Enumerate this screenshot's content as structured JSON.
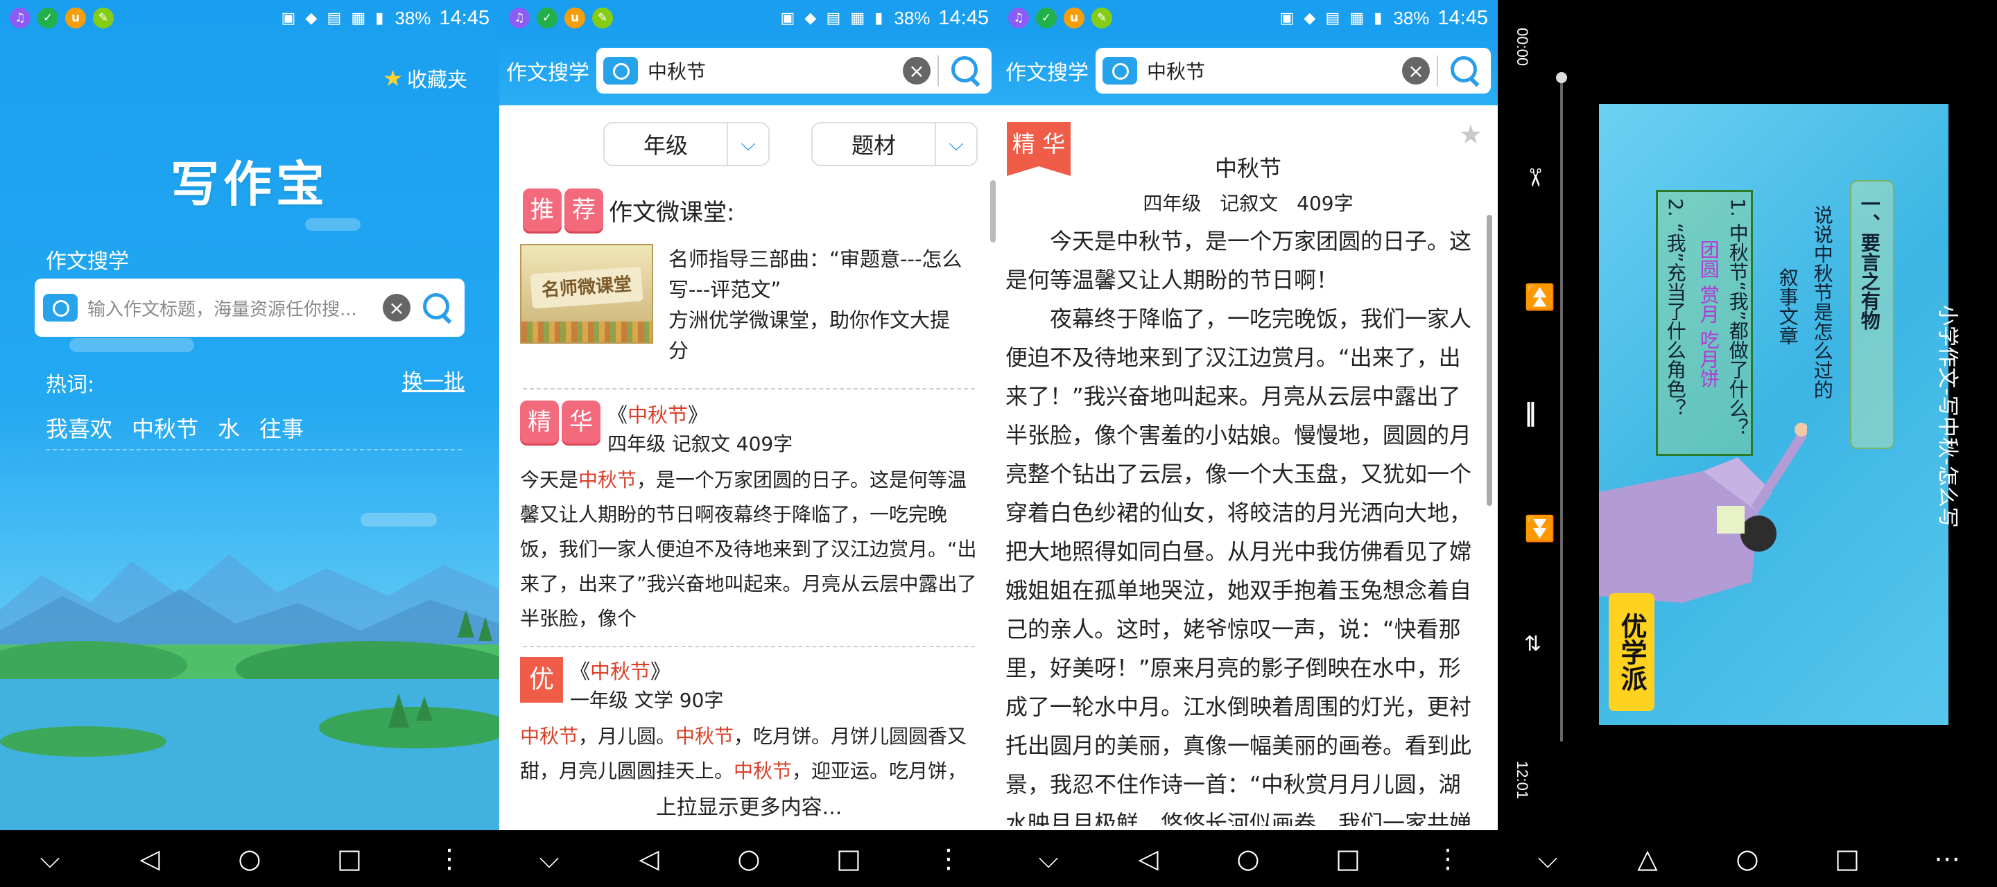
{
  "status": {
    "battery": "38%",
    "time": "14:45"
  },
  "nav": {
    "back": "◁",
    "home": "○",
    "recent": "□",
    "menu": "⋮",
    "down": "⌵"
  },
  "home": {
    "favorites": "收藏夹",
    "app_title": "写作宝",
    "search_label": "作文搜学",
    "search_placeholder": "输入作文标题，海量资源任你搜...",
    "hot_label": "热词:",
    "refresh": "换一批",
    "keywords": [
      "我喜欢",
      "中秋节",
      "水",
      "往事"
    ]
  },
  "search": {
    "label": "作文搜学",
    "query": "中秋节",
    "filters": [
      "年级",
      "题材"
    ],
    "recommend_tag": [
      "推",
      "荐"
    ],
    "recommend_label": "作文微课堂:",
    "course": {
      "thumb_text": "名师微课堂",
      "line1": "名师指导三部曲：“审题意---怎么写---评范文”",
      "line2": "方洲优学微课堂，助你作文大提分"
    },
    "result1": {
      "tag": [
        "精",
        "华"
      ],
      "title_open": "《",
      "title": "中秋节",
      "title_close": "》",
      "meta": "四年级 记叙文 409字",
      "b1": "今天是",
      "b2": "中秋节",
      "b3": "，是一个万家团圆的日子。这是何等温馨又让人期盼的节日啊夜幕终于降临了，一吃完晚饭，我们一家人便迫不及待地来到了汉江边赏月。“出来了，出来了”我兴奋地叫起来。月亮从云层中露出了半张脸，像个"
    },
    "result2": {
      "tag": "优",
      "title_open": "《",
      "title": "中秋节",
      "title_close": "》",
      "meta": "一年级 文学 90字",
      "s1": "中秋节",
      "s2": "，月儿圆。",
      "s3": "中秋节",
      "s4": "，吃月饼。月饼儿圆圆香又甜，月亮儿圆圆挂天上。",
      "s5": "中秋节",
      "s6": "，迎亚运。吃月饼，"
    },
    "more": "上拉显示更多内容..."
  },
  "article": {
    "tag": "精 华",
    "title": "中秋节",
    "meta": "四年级 记叙文 409字",
    "p1": "今天是中秋节，是一个万家团圆的日子。这是何等温馨又让人期盼的节日啊！",
    "p2": "夜幕终于降临了，一吃完晚饭，我们一家人便迫不及待地来到了汉江边赏月。“出来了，出来了！”我兴奋地叫起来。月亮从云层中露出了半张脸，像个害羞的小姑娘。慢慢地，圆圆的月亮整个钻出了云层，像一个大玉盘，又犹如一个穿着白色纱裙的仙女，将皎洁的月光洒向大地，把大地照得如同白昼。从月光中我仿佛看见了嫦娥姐姐在孤单地哭泣，她双手抱着玉兔想念着自己的亲人。这时，姥爷惊叹一声，说：“快看那里，好美呀！”原来月亮的影子倒映在水中，形成了一轮水中月。江水倒映着周围的灯光，更衬托出圆月的美丽，真像一幅美丽的画卷。看到此景，我忍不住作诗一首：“中秋赏月月儿圆，湖水映月月极鲜，悠悠长河似画卷，我们一家共婵娟。”大家一"
  },
  "video": {
    "elapsed": "00:00",
    "duration": "12:01",
    "title": "小学作文-写中秋-怎么写",
    "board_heading": "一、要言之有物",
    "board_line1": "说说中秋节是怎么过的",
    "board_line2": "叙事文章",
    "board_item1": "1. 中秋节“我”都做了什么？",
    "board_item1b": "团圆 赏月 吃月饼",
    "board_item2": "2. “我”充当了什么角色？",
    "logo": "优学派"
  }
}
